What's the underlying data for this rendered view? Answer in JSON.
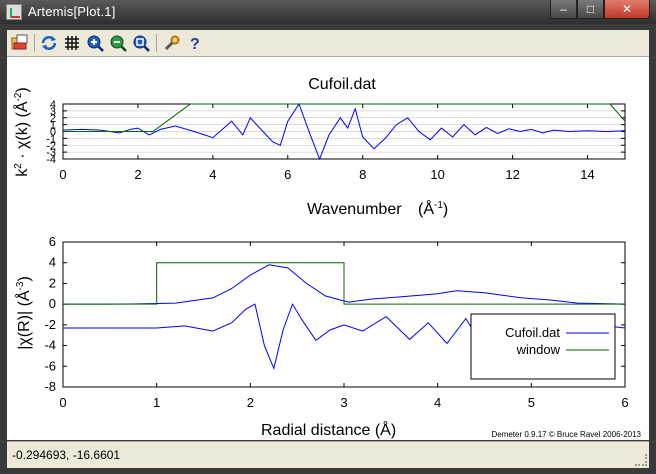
{
  "window": {
    "title": "Artemis[Plot.1]",
    "min_label": "–",
    "max_label": "□",
    "close_label": "✕"
  },
  "toolbar": {
    "icons": [
      "open-icon",
      "refresh-icon",
      "grid-icon",
      "zoom-in-icon",
      "zoom-out-icon",
      "zoom-reset-icon",
      "settings-icon",
      "help-icon"
    ]
  },
  "status": {
    "coordinates": "-0.294693, -16.6601"
  },
  "plot": {
    "credit": "Demeter 0.9.17 © Bruce Ravel 2006-2013"
  },
  "chart_data": [
    {
      "type": "line",
      "title": "Cufoil.dat",
      "xlabel": "Wavenumber (Å-1)",
      "ylabel": "k2 · χ(k) (Å-2)",
      "xlim": [
        0,
        15
      ],
      "ylim": [
        -4,
        4
      ],
      "xticks": [
        0,
        2,
        4,
        6,
        8,
        10,
        12,
        14
      ],
      "yticks": [
        -4,
        -3,
        -2,
        -1,
        0,
        1,
        2,
        3,
        4
      ],
      "grid": true,
      "colors": {
        "data": "#0000ff",
        "window": "#006400"
      },
      "series": [
        {
          "key": "chi",
          "x": [
            0,
            0.5,
            1.0,
            1.5,
            1.8,
            2.0,
            2.3,
            2.6,
            3.0,
            3.5,
            4.0,
            4.5,
            4.8,
            5.0,
            5.3,
            5.6,
            5.8,
            6.0,
            6.3,
            6.6,
            6.85,
            7.1,
            7.4,
            7.6,
            7.8,
            8.0,
            8.3,
            8.6,
            8.9,
            9.2,
            9.5,
            9.8,
            10.1,
            10.4,
            10.7,
            11.0,
            11.3,
            11.6,
            11.9,
            12.2,
            12.5,
            12.8,
            13.1,
            13.5,
            14.0,
            14.5,
            15.0
          ],
          "y": [
            0.2,
            0.3,
            0.2,
            -0.2,
            0.3,
            0.5,
            -0.5,
            0.3,
            0.8,
            0.0,
            -0.9,
            1.5,
            -0.5,
            2.0,
            0.2,
            -1.5,
            -2.0,
            1.5,
            4.0,
            -0.5,
            -4.0,
            -0.5,
            2.0,
            0.5,
            3.3,
            -0.8,
            -2.5,
            -1.0,
            1.0,
            2.0,
            0.0,
            -1.2,
            0.5,
            -0.8,
            1.0,
            -0.5,
            0.6,
            -0.3,
            0.4,
            0.0,
            0.3,
            -0.2,
            0.2,
            0.0,
            0.1,
            0.0,
            0.1
          ]
        },
        {
          "key": "window",
          "x": [
            0,
            2.4,
            3.4,
            14.6,
            15.0
          ],
          "y": [
            0,
            0,
            4,
            4,
            1.5
          ]
        }
      ]
    },
    {
      "type": "line",
      "xlabel": "Radial distance (Å)",
      "ylabel": "|χ(R)| (Å-3)",
      "xlim": [
        0,
        6
      ],
      "ylim": [
        -8,
        6
      ],
      "xticks": [
        0,
        1,
        2,
        3,
        4,
        5,
        6
      ],
      "yticks": [
        -8,
        -6,
        -4,
        -2,
        0,
        2,
        4,
        6
      ],
      "grid": false,
      "legend": "right",
      "series": [
        {
          "key": "magnitude",
          "name": "Cufoil.dat",
          "x": [
            0,
            0.4,
            0.8,
            1.2,
            1.6,
            1.8,
            2.0,
            2.2,
            2.4,
            2.6,
            2.8,
            3.0,
            3.05,
            3.3,
            3.6,
            4.0,
            4.2,
            4.5,
            4.9,
            5.2,
            5.5,
            6.0
          ],
          "y": [
            0,
            0,
            0.02,
            0.1,
            0.6,
            1.5,
            2.8,
            3.8,
            3.5,
            2.0,
            0.8,
            0.3,
            0.2,
            0.5,
            0.7,
            1.0,
            1.3,
            1.1,
            0.6,
            0.4,
            0.1,
            0.0
          ]
        },
        {
          "key": "real",
          "x": [
            0,
            0.5,
            1.0,
            1.3,
            1.6,
            1.8,
            1.95,
            2.05,
            2.15,
            2.25,
            2.35,
            2.45,
            2.55,
            2.7,
            2.85,
            3.0,
            3.2,
            3.45,
            3.7,
            3.9,
            4.1,
            4.3,
            4.45,
            4.6,
            4.75,
            4.9,
            5.1,
            5.3,
            5.5,
            5.8,
            6.0
          ],
          "y": [
            -2.3,
            -2.3,
            -2.3,
            -2.1,
            -2.6,
            -1.8,
            -0.5,
            0.0,
            -4.0,
            -6.2,
            -2.5,
            0.0,
            -1.5,
            -3.5,
            -2.5,
            -2.0,
            -2.6,
            -1.2,
            -3.4,
            -1.8,
            -3.8,
            -1.4,
            -3.6,
            -1.2,
            -3.0,
            -2.0,
            -2.8,
            -1.9,
            -2.4,
            -2.1,
            -2.3
          ]
        },
        {
          "key": "window",
          "name": "window",
          "x": [
            0,
            1.0,
            1.0,
            3.0,
            3.0,
            6.0
          ],
          "y": [
            0,
            0,
            4,
            4,
            0,
            0
          ]
        }
      ]
    }
  ]
}
